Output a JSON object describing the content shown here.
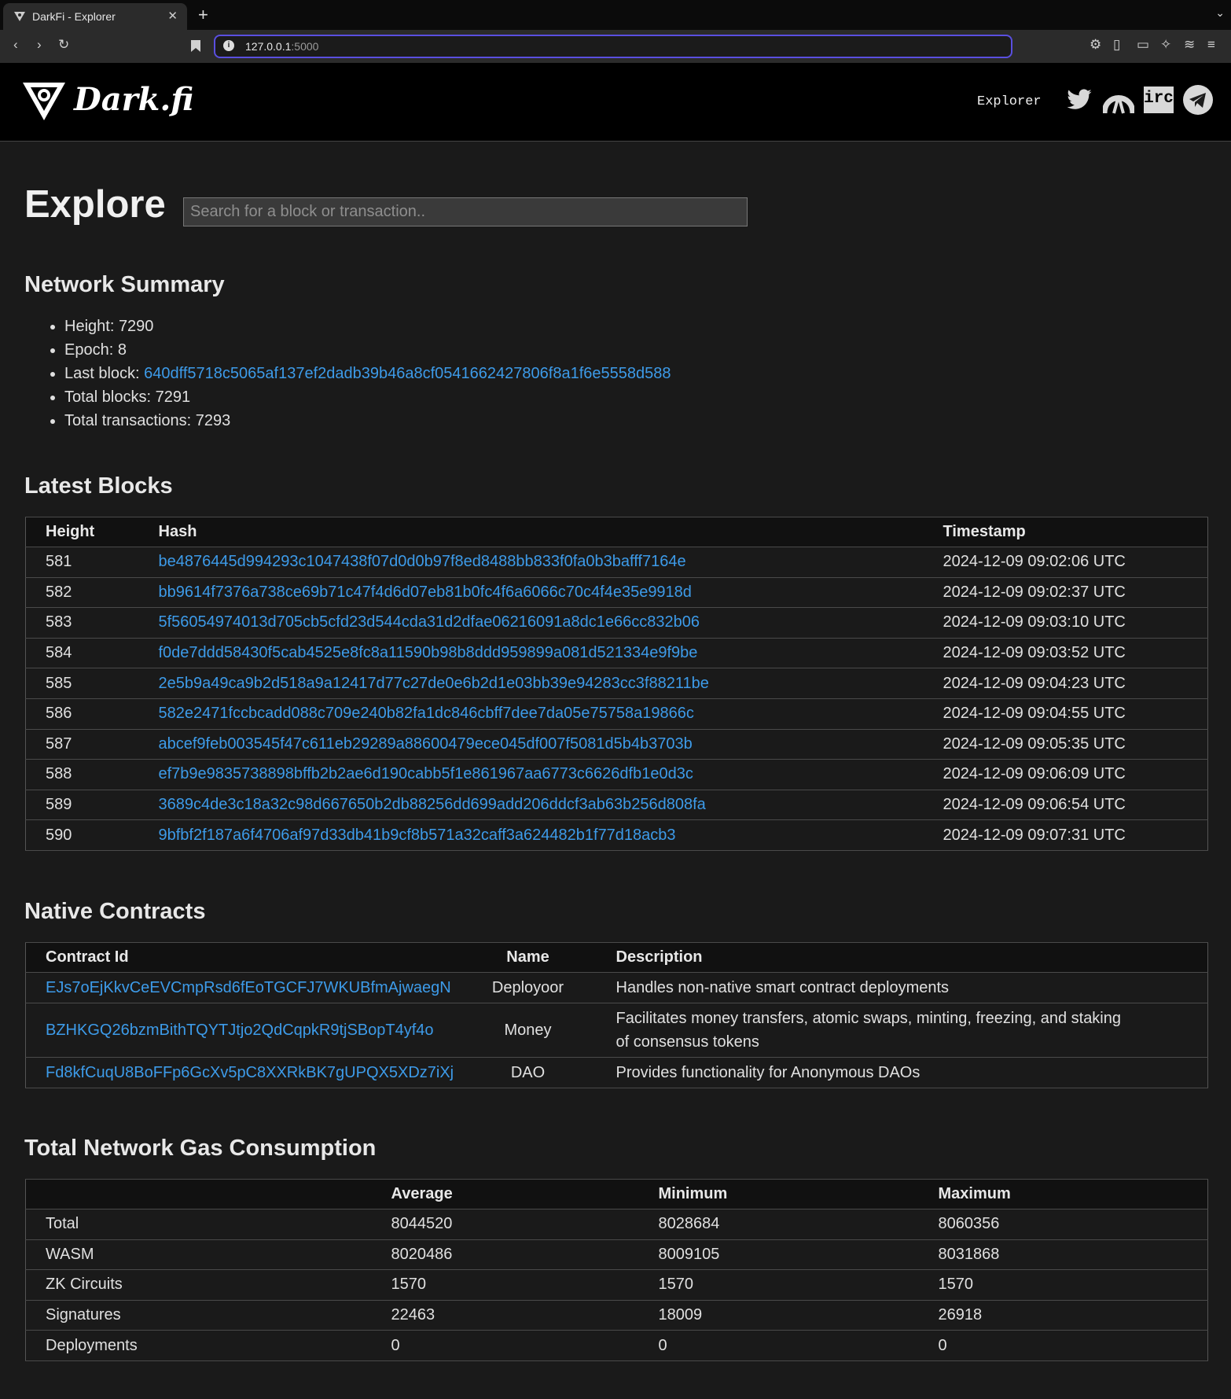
{
  "browser": {
    "tab_title": "DarkFi - Explorer",
    "url_host": "127.0.0.1",
    "url_port": ":5000"
  },
  "header": {
    "logo_text": "Dark.fi",
    "nav_explorer": "Explorer",
    "irc_label": "irc",
    "social_icons": [
      "twitter-icon",
      "mastodon-icon",
      "irc-icon",
      "telegram-icon"
    ]
  },
  "page": {
    "title": "Explore",
    "search_placeholder": "Search for a block or transaction.."
  },
  "summary": {
    "heading": "Network Summary",
    "height_label": "Height: ",
    "height": "7290",
    "epoch_label": "Epoch: ",
    "epoch": "8",
    "last_block_label": "Last block: ",
    "last_block": "640dff5718c5065af137ef2dadb39b46a8cf0541662427806f8a1f6e5558d588",
    "total_blocks_label": "Total blocks: ",
    "total_blocks": "7291",
    "total_tx_label": "Total transactions: ",
    "total_tx": "7293"
  },
  "blocks": {
    "heading": "Latest Blocks",
    "columns": [
      "Height",
      "Hash",
      "Timestamp"
    ],
    "rows": [
      {
        "height": "581",
        "hash": "be4876445d994293c1047438f07d0d0b97f8ed8488bb833f0fa0b3bafff7164e",
        "ts": "2024-12-09 09:02:06 UTC"
      },
      {
        "height": "582",
        "hash": "bb9614f7376a738ce69b71c47f4d6d07eb81b0fc4f6a6066c70c4f4e35e9918d",
        "ts": "2024-12-09 09:02:37 UTC"
      },
      {
        "height": "583",
        "hash": "5f56054974013d705cb5cfd23d544cda31d2dfae06216091a8dc1e66cc832b06",
        "ts": "2024-12-09 09:03:10 UTC"
      },
      {
        "height": "584",
        "hash": "f0de7ddd58430f5cab4525e8fc8a11590b98b8ddd959899a081d521334e9f9be",
        "ts": "2024-12-09 09:03:52 UTC"
      },
      {
        "height": "585",
        "hash": "2e5b9a49ca9b2d518a9a12417d77c27de0e6b2d1e03bb39e94283cc3f88211be",
        "ts": "2024-12-09 09:04:23 UTC"
      },
      {
        "height": "586",
        "hash": "582e2471fccbcadd088c709e240b82fa1dc846cbff7dee7da05e75758a19866c",
        "ts": "2024-12-09 09:04:55 UTC"
      },
      {
        "height": "587",
        "hash": "abcef9feb003545f47c611eb29289a88600479ece045df007f5081d5b4b3703b",
        "ts": "2024-12-09 09:05:35 UTC"
      },
      {
        "height": "588",
        "hash": "ef7b9e9835738898bffb2b2ae6d190cabb5f1e861967aa6773c6626dfb1e0d3c",
        "ts": "2024-12-09 09:06:09 UTC"
      },
      {
        "height": "589",
        "hash": "3689c4de3c18a32c98d667650b2db88256dd699add206ddcf3ab63b256d808fa",
        "ts": "2024-12-09 09:06:54 UTC"
      },
      {
        "height": "590",
        "hash": "9bfbf2f187a6f4706af97d33db41b9cf8b571a32caff3a624482b1f77d18acb3",
        "ts": "2024-12-09 09:07:31 UTC"
      }
    ]
  },
  "contracts": {
    "heading": "Native Contracts",
    "columns": [
      "Contract Id",
      "Name",
      "Description"
    ],
    "rows": [
      {
        "id": "EJs7oEjKkvCeEVCmpRsd6fEoTGCFJ7WKUBfmAjwaegN",
        "name": "Deployoor",
        "desc": "Handles non-native smart contract deployments"
      },
      {
        "id": "BZHKGQ26bzmBithTQYTJtjo2QdCqpkR9tjSBopT4yf4o",
        "name": "Money",
        "desc": "Facilitates money transfers, atomic swaps, minting, freezing, and staking of consensus tokens"
      },
      {
        "id": "Fd8kfCuqU8BoFFp6GcXv5pC8XXRkBK7gUPQX5XDz7iXj",
        "name": "DAO",
        "desc": "Provides functionality for Anonymous DAOs"
      }
    ]
  },
  "gas": {
    "heading": "Total Network Gas Consumption",
    "columns": [
      "",
      "Average",
      "Minimum",
      "Maximum"
    ],
    "rows": [
      {
        "label": "Total",
        "avg": "8044520",
        "min": "8028684",
        "max": "8060356"
      },
      {
        "label": "WASM",
        "avg": "8020486",
        "min": "8009105",
        "max": "8031868"
      },
      {
        "label": "ZK Circuits",
        "avg": "1570",
        "min": "1570",
        "max": "1570"
      },
      {
        "label": "Signatures",
        "avg": "22463",
        "min": "18009",
        "max": "26918"
      },
      {
        "label": "Deployments",
        "avg": "0",
        "min": "0",
        "max": "0"
      }
    ]
  }
}
